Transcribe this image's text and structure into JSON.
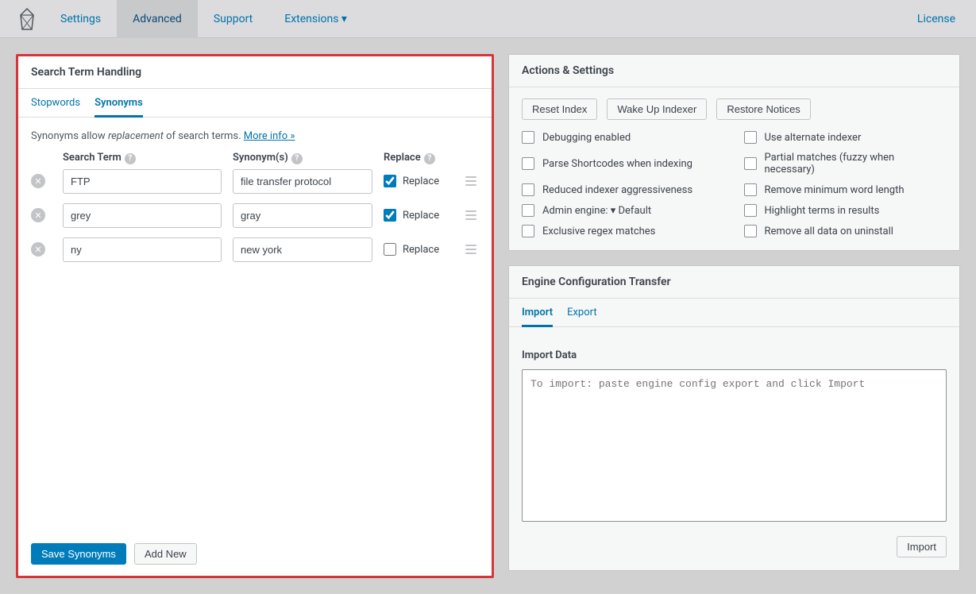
{
  "nav": {
    "items": [
      "Settings",
      "Advanced",
      "Support",
      "Extensions ▾"
    ],
    "right": "License",
    "active_index": 1
  },
  "left_panel": {
    "title": "Search Term Handling",
    "tabs": [
      "Stopwords",
      "Synonyms"
    ],
    "active_tab": 1,
    "desc_prefix": "Synonyms allow ",
    "desc_em": "replacement",
    "desc_suffix": " of search terms. ",
    "desc_link": "More info »",
    "headers": {
      "term": "Search Term",
      "syn": "Synonym(s)",
      "replace": "Replace"
    },
    "rows": [
      {
        "term": "FTP",
        "syn": "file transfer protocol",
        "replace": true,
        "label": "Replace"
      },
      {
        "term": "grey",
        "syn": "gray",
        "replace": true,
        "label": "Replace"
      },
      {
        "term": "ny",
        "syn": "new york",
        "replace": false,
        "label": "Replace"
      }
    ],
    "save_label": "Save Synonyms",
    "add_label": "Add New"
  },
  "actions_panel": {
    "title": "Actions & Settings",
    "buttons": [
      "Reset Index",
      "Wake Up Indexer",
      "Restore Notices"
    ],
    "checks_left": [
      "Debugging enabled",
      "Parse Shortcodes when indexing",
      "Reduced indexer aggressiveness",
      "Admin engine: ▾ Default",
      "Exclusive regex matches"
    ],
    "checks_right": [
      "Use alternate indexer",
      "Partial matches (fuzzy when necessary)",
      "Remove minimum word length",
      "Highlight terms in results",
      "Remove all data on uninstall"
    ]
  },
  "transfer_panel": {
    "title": "Engine Configuration Transfer",
    "tabs": [
      "Import",
      "Export"
    ],
    "active_tab": 0,
    "import_label": "Import Data",
    "placeholder": "To import: paste engine config export and click Import",
    "import_btn": "Import"
  }
}
